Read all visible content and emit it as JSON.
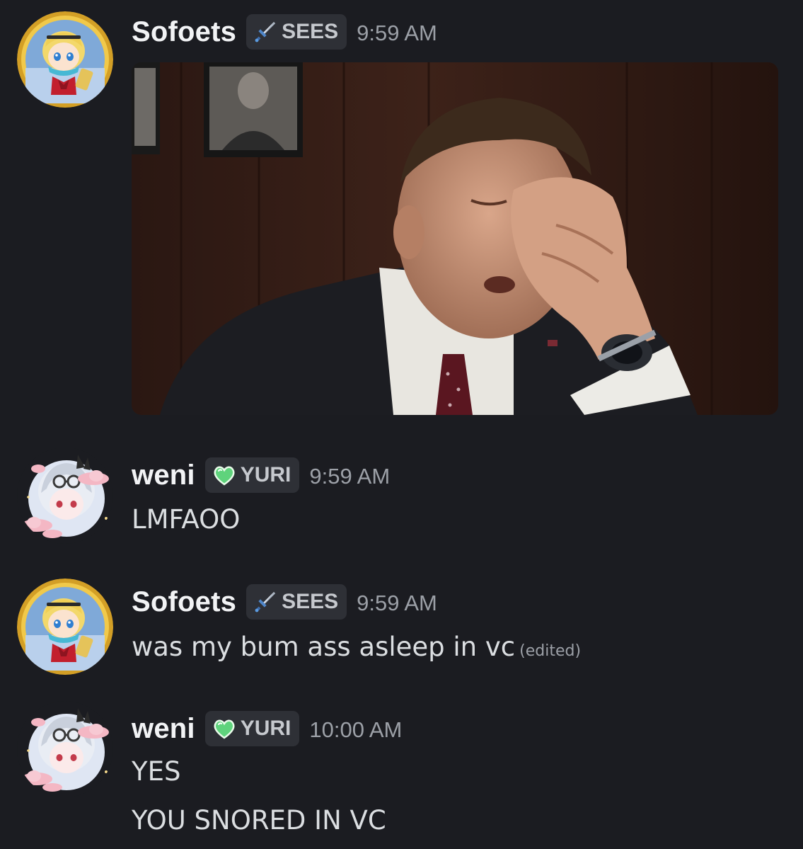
{
  "messages": [
    {
      "username": "Sofoets",
      "tag_icon": "sword-icon",
      "tag_label": "SEES",
      "timestamp": "9:59 AM",
      "attachment": "gif-facepalm-man-in-suit"
    },
    {
      "username": "weni",
      "tag_icon": "green-heart-icon",
      "tag_label": "YURI",
      "timestamp": "9:59 AM",
      "lines": [
        "LMFAOO"
      ]
    },
    {
      "username": "Sofoets",
      "tag_icon": "sword-icon",
      "tag_label": "SEES",
      "timestamp": "9:59 AM",
      "lines": [
        "was my bum ass asleep in vc"
      ],
      "edited_label": "(edited)"
    },
    {
      "username": "weni",
      "tag_icon": "green-heart-icon",
      "tag_label": "YURI",
      "timestamp": "10:00 AM",
      "lines": [
        "YES",
        "YOU SNORED IN VC"
      ]
    }
  ],
  "colors": {
    "background": "#1b1c21",
    "username": "#f2f3f5",
    "message_text": "#dbdee1",
    "timestamp": "#9ca0a7",
    "tag_background": "#2e3036",
    "avatar_ring_gold": "#c8961e",
    "heart_green": "#5fd37c"
  }
}
